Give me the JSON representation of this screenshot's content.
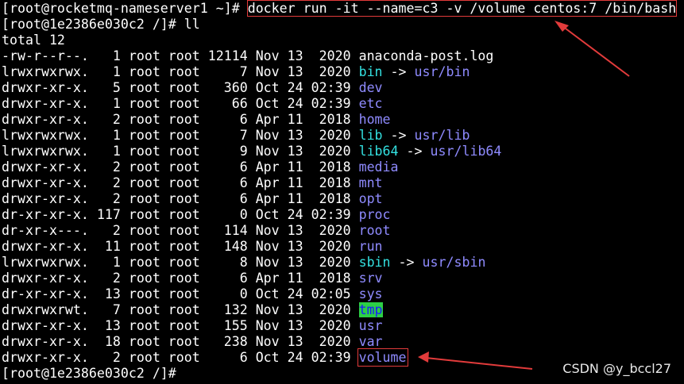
{
  "terminal": {
    "prompt_host": "[root@rocketmq-nameserver1 ~]# ",
    "command": "docker run -it --name=c3 -v /volume centos:7 /bin/bash",
    "prompt_container_1": "[root@1e2386e030c2 /]# ",
    "command_2": "ll",
    "total_line": "total 12",
    "entries": [
      {
        "meta": "-rw-r--r--.   1 root root 12114 Nov 13  2020 ",
        "name": "anaconda-post.log",
        "type": "file",
        "arrow": "",
        "target": ""
      },
      {
        "meta": "lrwxrwxrwx.   1 root root     7 Nov 13  2020 ",
        "name": "bin",
        "type": "link",
        "arrow": " -> ",
        "target": "usr/bin"
      },
      {
        "meta": "drwxr-xr-x.   5 root root   360 Oct 24 02:39 ",
        "name": "dev",
        "type": "dir",
        "arrow": "",
        "target": ""
      },
      {
        "meta": "drwxr-xr-x.   1 root root    66 Oct 24 02:39 ",
        "name": "etc",
        "type": "dir",
        "arrow": "",
        "target": ""
      },
      {
        "meta": "drwxr-xr-x.   2 root root     6 Apr 11  2018 ",
        "name": "home",
        "type": "dir",
        "arrow": "",
        "target": ""
      },
      {
        "meta": "lrwxrwxrwx.   1 root root     7 Nov 13  2020 ",
        "name": "lib",
        "type": "link",
        "arrow": " -> ",
        "target": "usr/lib"
      },
      {
        "meta": "lrwxrwxrwx.   1 root root     9 Nov 13  2020 ",
        "name": "lib64",
        "type": "link",
        "arrow": " -> ",
        "target": "usr/lib64"
      },
      {
        "meta": "drwxr-xr-x.   2 root root     6 Apr 11  2018 ",
        "name": "media",
        "type": "dir",
        "arrow": "",
        "target": ""
      },
      {
        "meta": "drwxr-xr-x.   2 root root     6 Apr 11  2018 ",
        "name": "mnt",
        "type": "dir",
        "arrow": "",
        "target": ""
      },
      {
        "meta": "drwxr-xr-x.   2 root root     6 Apr 11  2018 ",
        "name": "opt",
        "type": "dir",
        "arrow": "",
        "target": ""
      },
      {
        "meta": "dr-xr-xr-x. 117 root root     0 Oct 24 02:39 ",
        "name": "proc",
        "type": "dir",
        "arrow": "",
        "target": ""
      },
      {
        "meta": "dr-xr-x---.   2 root root   114 Nov 13  2020 ",
        "name": "root",
        "type": "dir",
        "arrow": "",
        "target": ""
      },
      {
        "meta": "drwxr-xr-x.  11 root root   148 Nov 13  2020 ",
        "name": "run",
        "type": "dir",
        "arrow": "",
        "target": ""
      },
      {
        "meta": "lrwxrwxrwx.   1 root root     8 Nov 13  2020 ",
        "name": "sbin",
        "type": "link",
        "arrow": " -> ",
        "target": "usr/sbin"
      },
      {
        "meta": "drwxr-xr-x.   2 root root     6 Apr 11  2018 ",
        "name": "srv",
        "type": "dir",
        "arrow": "",
        "target": ""
      },
      {
        "meta": "dr-xr-xr-x.  13 root root     0 Oct 24 02:05 ",
        "name": "sys",
        "type": "dir",
        "arrow": "",
        "target": ""
      },
      {
        "meta": "drwxrwxrwt.   7 root root   132 Nov 13  2020 ",
        "name": "tmp",
        "type": "tmpdir",
        "arrow": "",
        "target": ""
      },
      {
        "meta": "drwxr-xr-x.  13 root root   155 Nov 13  2020 ",
        "name": "usr",
        "type": "dir",
        "arrow": "",
        "target": ""
      },
      {
        "meta": "drwxr-xr-x.  18 root root   238 Nov 13  2020 ",
        "name": "var",
        "type": "dir",
        "arrow": "",
        "target": ""
      },
      {
        "meta": "drwxr-xr-x.   2 root root     6 Oct 24 02:39 ",
        "name": "volume",
        "type": "dir-highlight",
        "arrow": "",
        "target": ""
      }
    ],
    "prompt_container_2": "[root@1e2386e030c2 /]# "
  },
  "watermark": "CSDN @y_bccl27",
  "colors": {
    "background": "#000000",
    "text": "#ffffff",
    "directory": "#8f8bff",
    "symlink": "#33e0e0",
    "sticky_dir_bg": "#2ccf45",
    "annotation_red": "#e23b3b"
  }
}
